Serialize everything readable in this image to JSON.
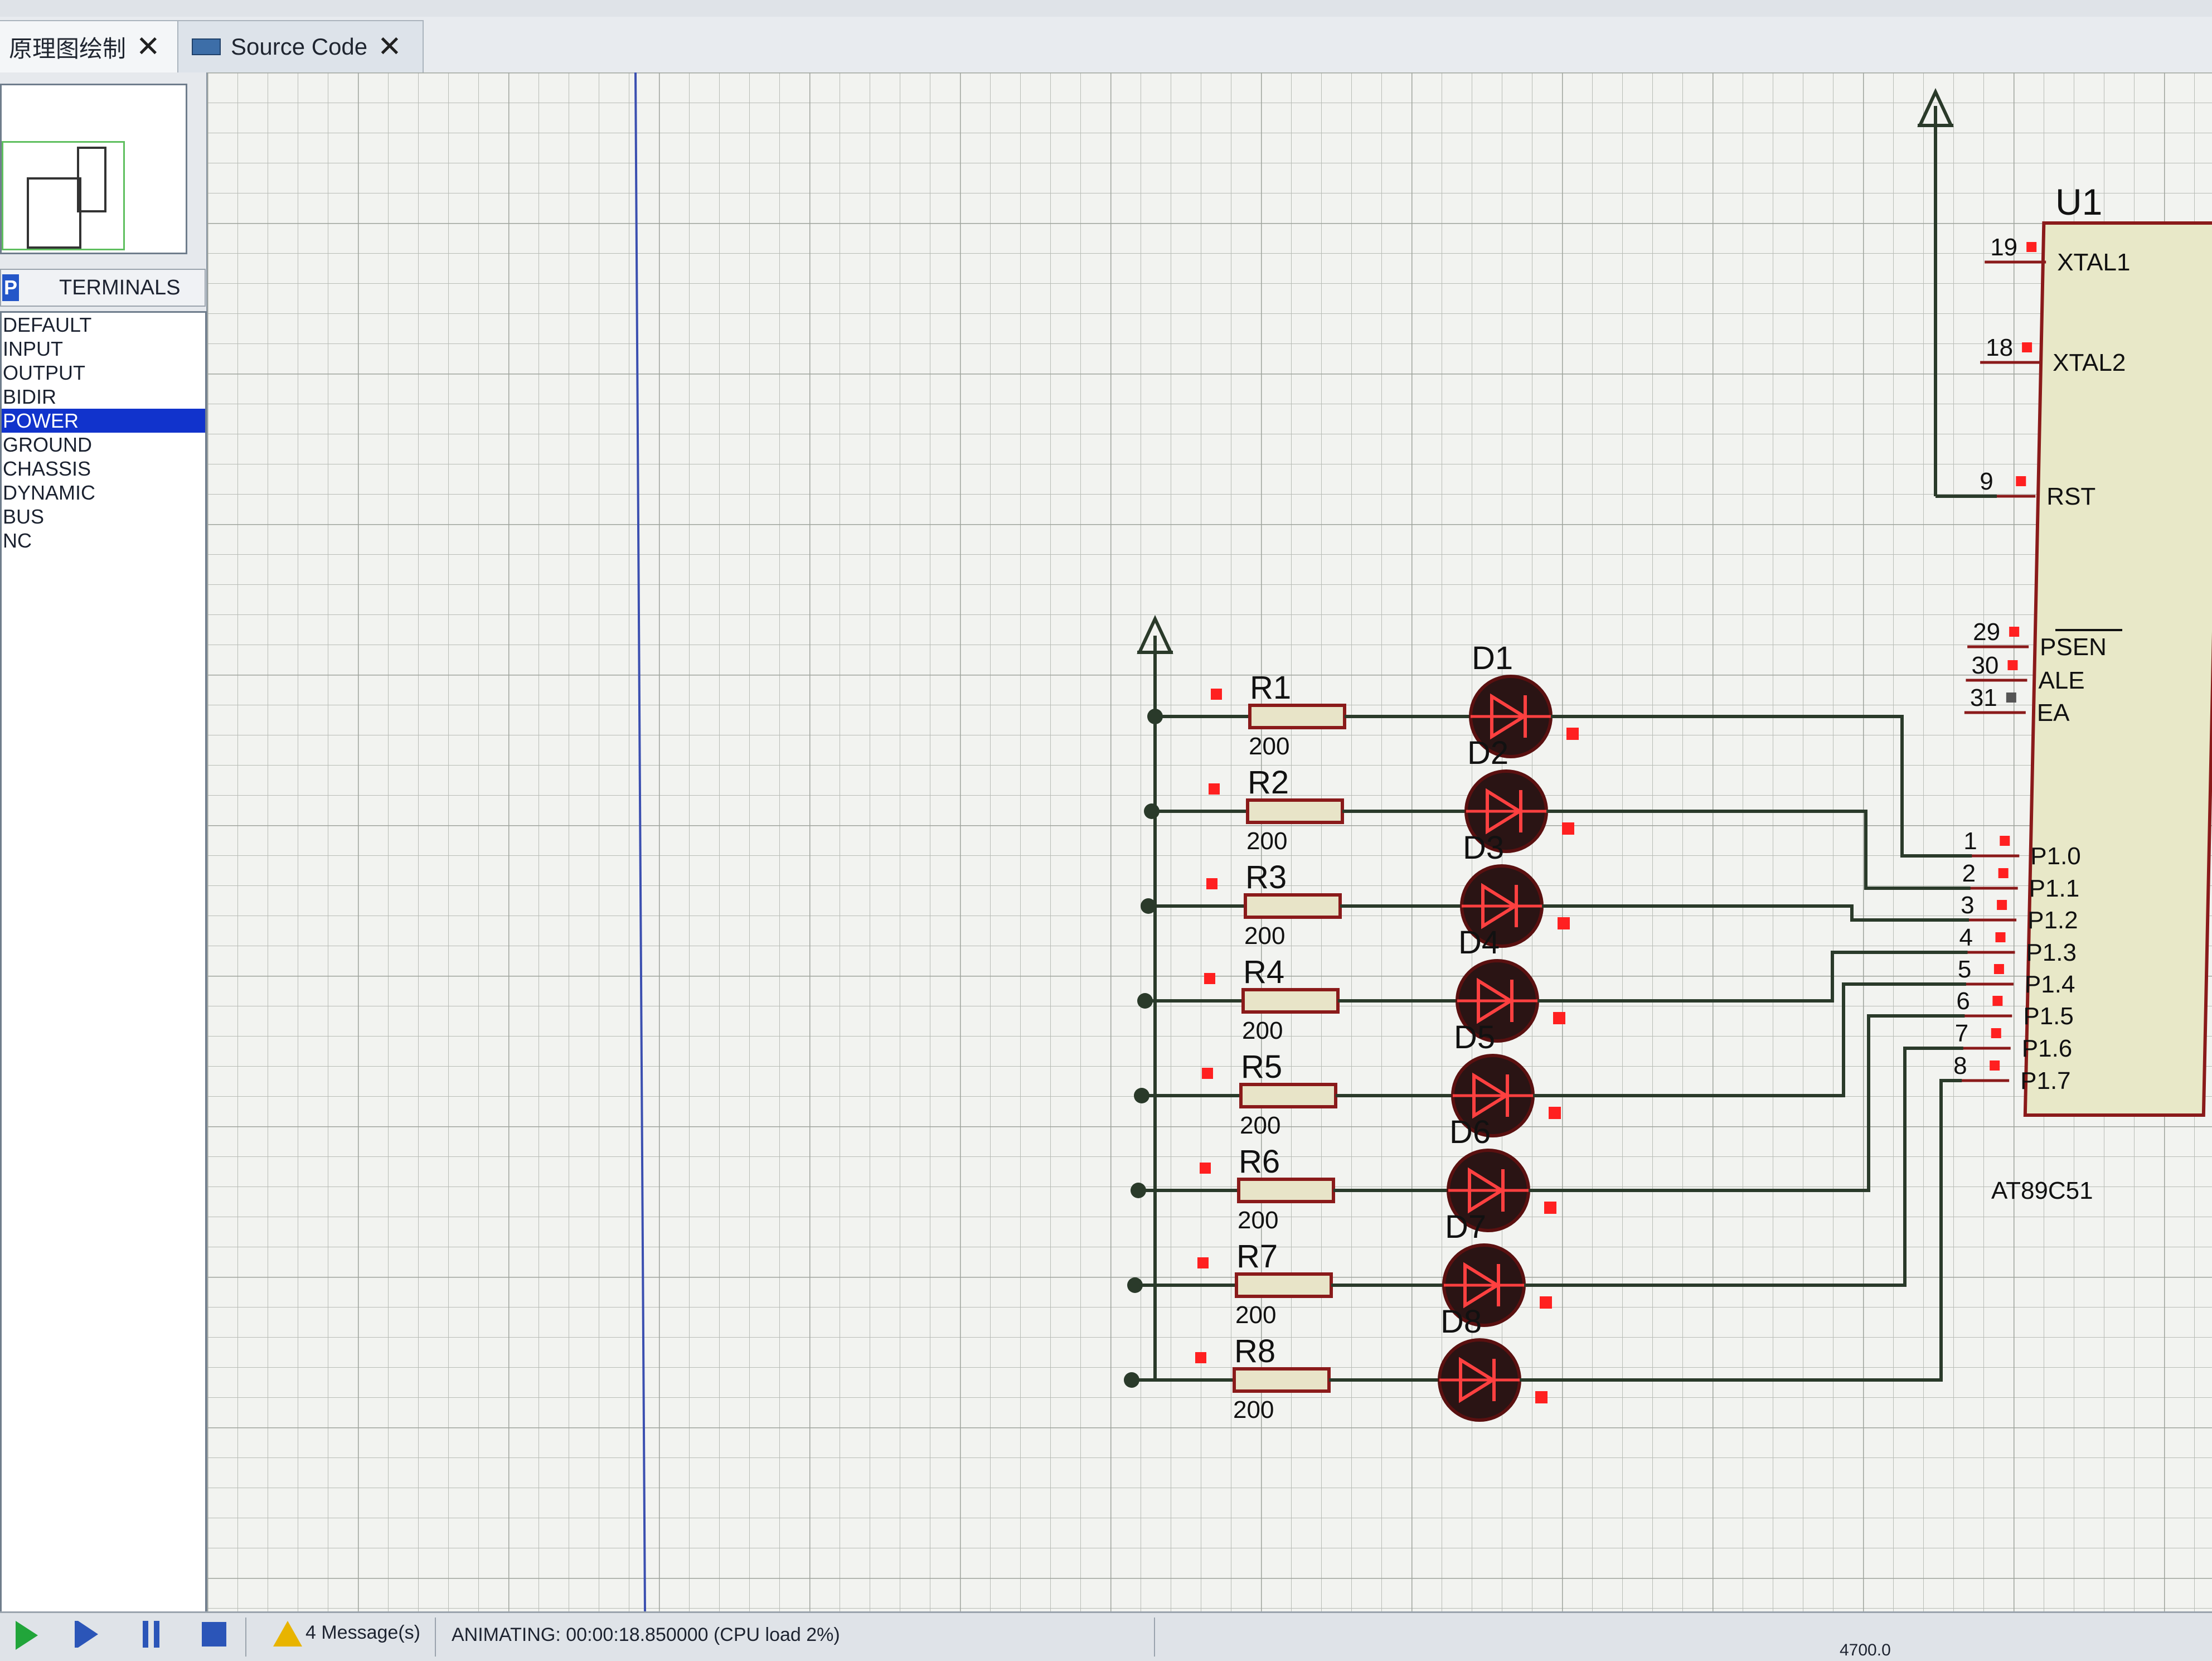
{
  "tabs": [
    {
      "label": "原理图绘制"
    },
    {
      "label": "Source Code"
    }
  ],
  "terminals": {
    "mode_button": "P",
    "title": "TERMINALS",
    "items": [
      "DEFAULT",
      "INPUT",
      "OUTPUT",
      "BIDIR",
      "POWER",
      "GROUND",
      "CHASSIS",
      "DYNAMIC",
      "BUS",
      "NC"
    ],
    "selected": "POWER"
  },
  "schematic": {
    "chip": {
      "ref": "U1",
      "part": "AT89C51",
      "pins": [
        {
          "num": "19",
          "name": "XTAL1"
        },
        {
          "num": "18",
          "name": "XTAL2"
        },
        {
          "num": "9",
          "name": "RST"
        },
        {
          "num": "29",
          "name": "PSEN"
        },
        {
          "num": "30",
          "name": "ALE"
        },
        {
          "num": "31",
          "name": "EA"
        },
        {
          "num": "1",
          "name": "P1.0"
        },
        {
          "num": "2",
          "name": "P1.1"
        },
        {
          "num": "3",
          "name": "P1.2"
        },
        {
          "num": "4",
          "name": "P1.3"
        },
        {
          "num": "5",
          "name": "P1.4"
        },
        {
          "num": "6",
          "name": "P1.5"
        },
        {
          "num": "7",
          "name": "P1.6"
        },
        {
          "num": "8",
          "name": "P1.7"
        }
      ]
    },
    "resistors": [
      {
        "ref": "R1",
        "value": "200"
      },
      {
        "ref": "R2",
        "value": "200"
      },
      {
        "ref": "R3",
        "value": "200"
      },
      {
        "ref": "R4",
        "value": "200"
      },
      {
        "ref": "R5",
        "value": "200"
      },
      {
        "ref": "R6",
        "value": "200"
      },
      {
        "ref": "R7",
        "value": "200"
      },
      {
        "ref": "R8",
        "value": "200"
      }
    ],
    "leds": [
      {
        "ref": "D1"
      },
      {
        "ref": "D2"
      },
      {
        "ref": "D3"
      },
      {
        "ref": "D4"
      },
      {
        "ref": "D5"
      },
      {
        "ref": "D6"
      },
      {
        "ref": "D7"
      },
      {
        "ref": "D8"
      }
    ]
  },
  "status": {
    "messages": "4 Message(s)",
    "animating": "ANIMATING: 00:00:18.850000 (CPU load 2%)",
    "coord": "4700.0"
  },
  "colors": {
    "grid": "#b8bcb6",
    "wire": "#2a3a2a",
    "component_outline": "#8a1a1a",
    "led_fill": "#2a1414",
    "pin_marker": "#ff2020",
    "chip_fill": "#e8e8c8",
    "resistor_fill": "#e8e4c8"
  }
}
